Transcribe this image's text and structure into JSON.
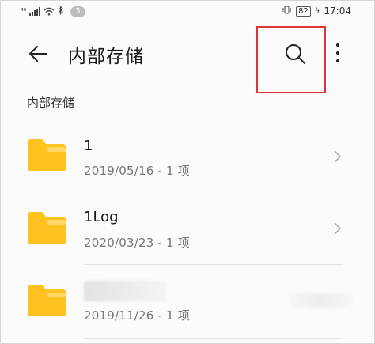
{
  "status_bar": {
    "network_label": "⁴⁶",
    "notification_count": "3",
    "battery": "82",
    "time": "17:04"
  },
  "app_bar": {
    "title": "内部存储",
    "back_icon": "arrow-left-icon",
    "search_icon": "search-icon",
    "more_icon": "more-vertical-icon"
  },
  "breadcrumb": "内部存储",
  "files": [
    {
      "name": "1",
      "meta": "2019/05/16 - 1 项"
    },
    {
      "name": "1Log",
      "meta": "2020/03/23 - 1 项"
    },
    {
      "name": "",
      "meta": "2019/11/26 - 1 项"
    }
  ],
  "colors": {
    "folder": "#ffc21f",
    "folder_tab": "#ffd866",
    "highlight": "#e03434"
  }
}
